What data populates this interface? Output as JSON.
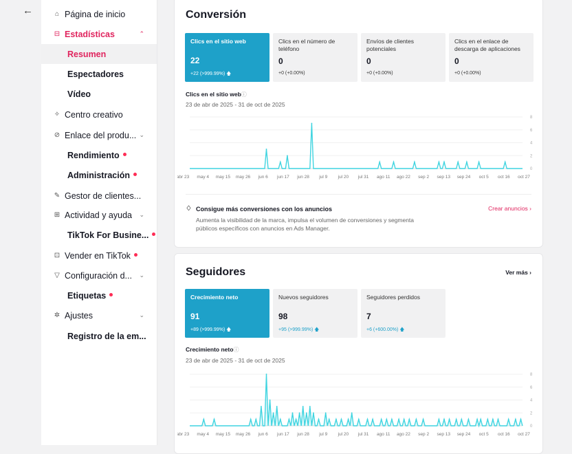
{
  "back_icon": "arrow-left-icon",
  "sidebar": {
    "items": [
      {
        "label": "Página de inicio",
        "icon": "home-icon",
        "glyph": "⌂"
      },
      {
        "label": "Estadísticas",
        "icon": "chart-icon",
        "glyph": "⊟"
      },
      {
        "label": "Resumen"
      },
      {
        "label": "Espectadores"
      },
      {
        "label": "Vídeo"
      },
      {
        "label": "Centro creativo",
        "icon": "lightbulb-icon",
        "glyph": "✧"
      },
      {
        "label": "Enlace del produ...",
        "icon": "link-icon",
        "glyph": "⊘"
      },
      {
        "label": "Rendimiento"
      },
      {
        "label": "Administración"
      },
      {
        "label": "Gestor de clientes...",
        "icon": "edit-icon",
        "glyph": "✎"
      },
      {
        "label": "Actividad y ayuda",
        "icon": "grid-icon",
        "glyph": "⊞"
      },
      {
        "label": "TikTok For Busine..."
      },
      {
        "label": "Vender en TikTok",
        "icon": "shop-icon",
        "glyph": "⊡"
      },
      {
        "label": "Configuración d...",
        "icon": "filter-icon",
        "glyph": "▽"
      },
      {
        "label": "Etiquetas"
      },
      {
        "label": "Ajustes",
        "icon": "gear-icon",
        "glyph": "✲"
      },
      {
        "label": "Registro de la em..."
      }
    ]
  },
  "conversion": {
    "title": "Conversión",
    "tiles": [
      {
        "label": "Clics en el sitio web",
        "value": "22",
        "change": "+22 (>999.99%) 🡅"
      },
      {
        "label": "Clics en el número de teléfono",
        "value": "0",
        "change": "+0 (+0.00%)"
      },
      {
        "label": "Envíos de clientes potenciales",
        "value": "0",
        "change": "+0 (+0.00%)"
      },
      {
        "label": "Clics en el enlace de descarga de aplicaciones",
        "value": "0",
        "change": "+0 (+0.00%)"
      }
    ],
    "chart_label": "Clics en el sitio web",
    "date_range": "23 de abr de 2025 - 31 de oct de 2025",
    "promo": {
      "title": "Consigue más conversiones con los anuncios",
      "desc": "Aumenta la visibilidad de la marca, impulsa el volumen de conversiones y segmenta públicos específicos con anuncios en Ads Manager.",
      "link": "Crear anuncios ›"
    }
  },
  "followers": {
    "title": "Seguidores",
    "see_more": "Ver más ›",
    "tiles": [
      {
        "label": "Crecimiento neto",
        "value": "91",
        "change": "+89 (>999.99%) 🡅"
      },
      {
        "label": "Nuevos seguidores",
        "value": "98",
        "change": "+95 (>999.99%) 🡅"
      },
      {
        "label": "Seguidores perdidos",
        "value": "7",
        "change": "+6 (+600.00%) 🡅"
      }
    ],
    "chart_label": "Crecimiento neto",
    "date_range": "23 de abr de 2025 - 31 de oct de 2025"
  },
  "colors": {
    "accent": "#e0245e",
    "teal": "#1ea1c9",
    "line": "#3fd4e0"
  },
  "chart_data": [
    {
      "type": "line",
      "x_ticks": [
        "abr 23",
        "may 4",
        "may 15",
        "may 26",
        "jun 6",
        "jun 17",
        "jun 28",
        "jul 9",
        "jul 20",
        "jul 31",
        "ago 11",
        "ago 22",
        "sep 2",
        "sep 13",
        "sep 24",
        "oct 5",
        "oct 16",
        "oct 27"
      ],
      "y_ticks": [
        "0",
        "2",
        "4",
        "6",
        "8"
      ],
      "ylim": [
        0,
        8
      ],
      "x_range": [
        "2025-04-23",
        "2025-10-31"
      ],
      "series": [
        {
          "points": [
            [
              "2025-06-06",
              3
            ],
            [
              "2025-06-14",
              1
            ],
            [
              "2025-06-18",
              2
            ],
            [
              "2025-07-02",
              7
            ],
            [
              "2025-08-10",
              1
            ],
            [
              "2025-08-18",
              1
            ],
            [
              "2025-08-30",
              1
            ],
            [
              "2025-09-13",
              1
            ],
            [
              "2025-09-16",
              1
            ],
            [
              "2025-09-24",
              1
            ],
            [
              "2025-09-29",
              1
            ],
            [
              "2025-10-06",
              1
            ],
            [
              "2025-10-21",
              1
            ]
          ]
        }
      ]
    },
    {
      "type": "area",
      "x_ticks": [
        "abr 23",
        "may 4",
        "may 15",
        "may 26",
        "jun 6",
        "jun 17",
        "jun 28",
        "jul 9",
        "jul 20",
        "jul 31",
        "ago 11",
        "ago 22",
        "sep 2",
        "sep 13",
        "sep 24",
        "oct 5",
        "oct 16",
        "oct 27"
      ],
      "y_ticks": [
        "0",
        "2",
        "4",
        "6",
        "8"
      ],
      "ylim": [
        0,
        8
      ],
      "x_range": [
        "2025-04-23",
        "2025-10-31"
      ],
      "series": [
        {
          "points": [
            [
              "2025-05-01",
              1
            ],
            [
              "2025-05-07",
              1
            ],
            [
              "2025-05-28",
              1
            ],
            [
              "2025-05-31",
              1
            ],
            [
              "2025-06-03",
              3
            ],
            [
              "2025-06-06",
              8
            ],
            [
              "2025-06-08",
              4
            ],
            [
              "2025-06-10",
              2
            ],
            [
              "2025-06-12",
              3
            ],
            [
              "2025-06-14",
              1
            ],
            [
              "2025-06-19",
              1
            ],
            [
              "2025-06-21",
              2
            ],
            [
              "2025-06-23",
              1
            ],
            [
              "2025-06-25",
              2
            ],
            [
              "2025-06-27",
              3
            ],
            [
              "2025-06-29",
              2
            ],
            [
              "2025-07-01",
              3
            ],
            [
              "2025-07-03",
              2
            ],
            [
              "2025-07-06",
              1
            ],
            [
              "2025-07-10",
              2
            ],
            [
              "2025-07-12",
              1
            ],
            [
              "2025-07-16",
              1
            ],
            [
              "2025-07-19",
              1
            ],
            [
              "2025-07-23",
              1
            ],
            [
              "2025-07-25",
              2
            ],
            [
              "2025-07-29",
              1
            ],
            [
              "2025-08-03",
              1
            ],
            [
              "2025-08-06",
              1
            ],
            [
              "2025-08-11",
              1
            ],
            [
              "2025-08-14",
              1
            ],
            [
              "2025-08-17",
              1
            ],
            [
              "2025-08-21",
              1
            ],
            [
              "2025-08-24",
              1
            ],
            [
              "2025-08-27",
              1
            ],
            [
              "2025-08-31",
              1
            ],
            [
              "2025-09-04",
              1
            ],
            [
              "2025-09-13",
              1
            ],
            [
              "2025-09-16",
              1
            ],
            [
              "2025-09-19",
              1
            ],
            [
              "2025-09-23",
              1
            ],
            [
              "2025-09-26",
              1
            ],
            [
              "2025-09-30",
              1
            ],
            [
              "2025-10-05",
              1
            ],
            [
              "2025-10-07",
              1
            ],
            [
              "2025-10-11",
              1
            ],
            [
              "2025-10-14",
              1
            ],
            [
              "2025-10-17",
              1
            ],
            [
              "2025-10-23",
              1
            ],
            [
              "2025-10-27",
              1
            ],
            [
              "2025-10-30",
              1
            ]
          ]
        }
      ]
    }
  ]
}
